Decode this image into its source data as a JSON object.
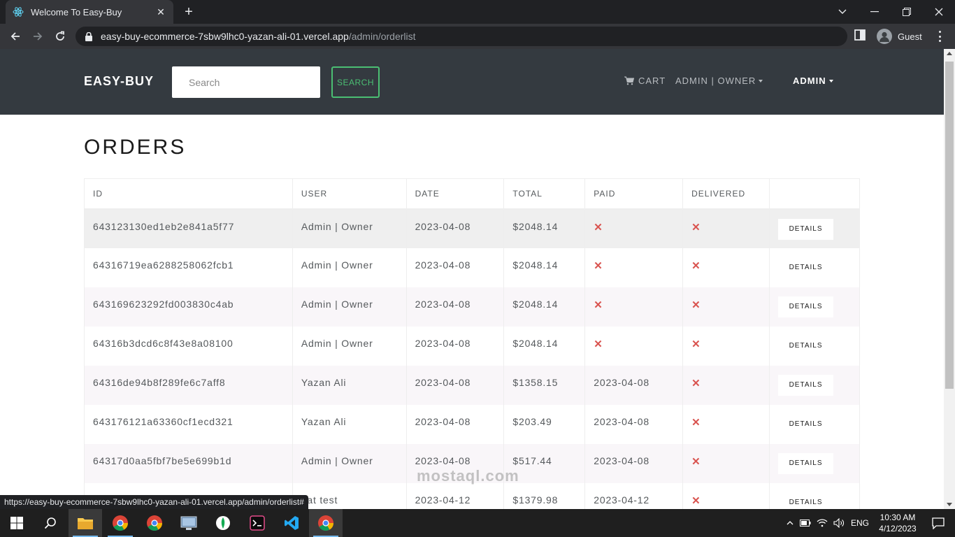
{
  "browser": {
    "tab_title": "Welcome To Easy-Buy",
    "url_host": "easy-buy-ecommerce-7sbw9lhc0-yazan-ali-01.vercel.app",
    "url_path": "/admin/orderlist",
    "profile_name": "Guest",
    "status_link": "https://easy-buy-ecommerce-7sbw9lhc0-yazan-ali-01.vercel.app/admin/orderlist#"
  },
  "navbar": {
    "brand": "EASY-BUY",
    "search_placeholder": "Search",
    "search_button": "SEARCH",
    "cart_label": "CART",
    "user_menu": "ADMIN | OWNER",
    "admin_menu": "ADMIN"
  },
  "page": {
    "title": "ORDERS"
  },
  "table": {
    "headers": {
      "id": "ID",
      "user": "USER",
      "date": "DATE",
      "total": "TOTAL",
      "paid": "PAID",
      "delivered": "DELIVERED"
    },
    "details_label": "DETAILS",
    "not_mark": "✕",
    "rows": [
      {
        "id": "643123130ed1eb2e841a5f77",
        "user": "Admin | Owner",
        "date": "2023-04-08",
        "total": "$2048.14",
        "paid": "",
        "delivered": ""
      },
      {
        "id": "64316719ea6288258062fcb1",
        "user": "Admin | Owner",
        "date": "2023-04-08",
        "total": "$2048.14",
        "paid": "",
        "delivered": ""
      },
      {
        "id": "643169623292fd003830c4ab",
        "user": "Admin | Owner",
        "date": "2023-04-08",
        "total": "$2048.14",
        "paid": "",
        "delivered": ""
      },
      {
        "id": "64316b3dcd6c8f43e8a08100",
        "user": "Admin | Owner",
        "date": "2023-04-08",
        "total": "$2048.14",
        "paid": "",
        "delivered": ""
      },
      {
        "id": "64316de94b8f289fe6c7aff8",
        "user": "Yazan Ali",
        "date": "2023-04-08",
        "total": "$1358.15",
        "paid": "2023-04-08",
        "delivered": ""
      },
      {
        "id": "643176121a63360cf1ecd321",
        "user": "Yazan Ali",
        "date": "2023-04-08",
        "total": "$203.49",
        "paid": "2023-04-08",
        "delivered": ""
      },
      {
        "id": "64317d0aa5fbf7be5e699b1d",
        "user": "Admin | Owner",
        "date": "2023-04-08",
        "total": "$517.44",
        "paid": "2023-04-08",
        "delivered": ""
      },
      {
        "id": "",
        "user": "hat test",
        "date": "2023-04-12",
        "total": "$1379.98",
        "paid": "2023-04-12",
        "delivered": ""
      }
    ]
  },
  "taskbar": {
    "language": "ENG",
    "time": "10:30 AM",
    "date": "4/12/2023"
  },
  "watermark": "mostaql.com",
  "colors": {
    "navbar_bg": "#343a40",
    "search_accent": "#4bbf73",
    "unpaid_mark": "#d9534f"
  }
}
